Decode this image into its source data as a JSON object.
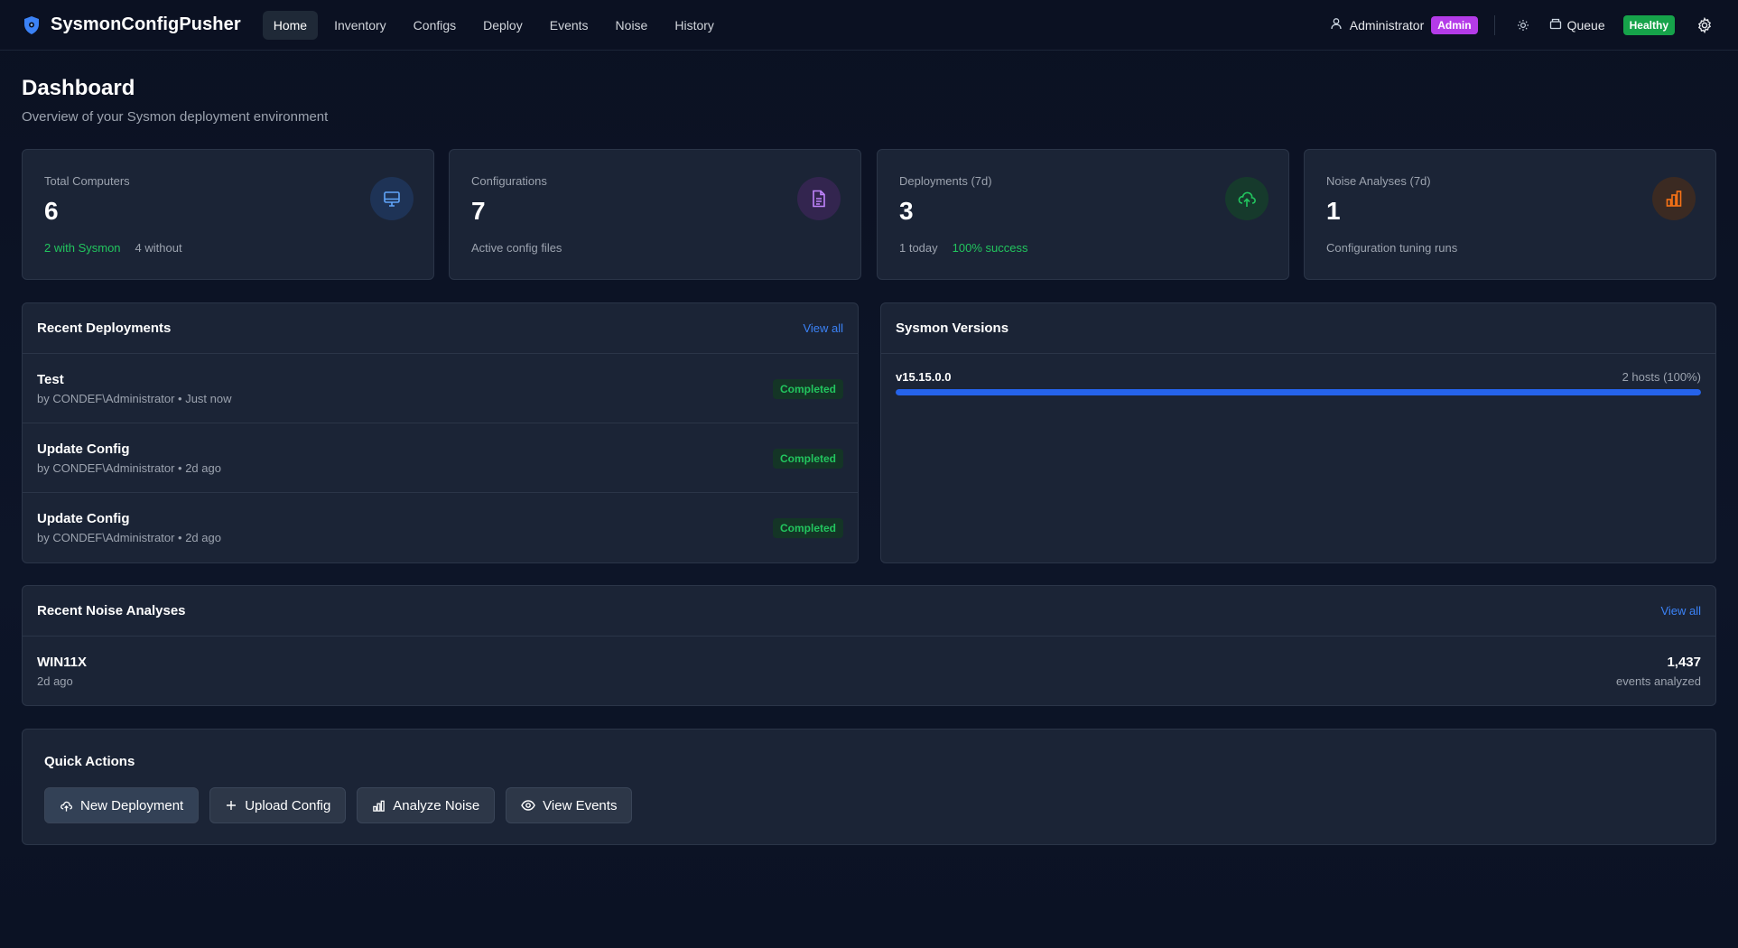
{
  "app": {
    "name": "SysmonConfigPusher",
    "nav": [
      "Home",
      "Inventory",
      "Configs",
      "Deploy",
      "Events",
      "Noise",
      "History"
    ],
    "active_nav": "Home",
    "user": "Administrator",
    "role_badge": "Admin",
    "queue_label": "Queue",
    "health_badge": "Healthy"
  },
  "page": {
    "title": "Dashboard",
    "subtitle": "Overview of your Sysmon deployment environment"
  },
  "stats": [
    {
      "label": "Total Computers",
      "value": "6",
      "foot": [
        "2 with Sysmon",
        "4 without"
      ],
      "icon": "monitor-icon",
      "color": "#60a5fa"
    },
    {
      "label": "Configurations",
      "value": "7",
      "foot": [
        "Active config files"
      ],
      "icon": "file-icon",
      "color": "#c084fc"
    },
    {
      "label": "Deployments (7d)",
      "value": "3",
      "foot": [
        "1 today",
        "100% success"
      ],
      "icon": "upload-cloud-icon",
      "color": "#22c55e"
    },
    {
      "label": "Noise Analyses (7d)",
      "value": "1",
      "foot": [
        "Configuration tuning runs"
      ],
      "icon": "bar-chart-icon",
      "color": "#f97316"
    }
  ],
  "recent_deployments": {
    "title": "Recent Deployments",
    "view_all": "View all",
    "items": [
      {
        "name": "Test",
        "meta": "by CONDEF\\Administrator • Just now",
        "status": "Completed"
      },
      {
        "name": "Update Config",
        "meta": "by CONDEF\\Administrator • 2d ago",
        "status": "Completed"
      },
      {
        "name": "Update Config",
        "meta": "by CONDEF\\Administrator • 2d ago",
        "status": "Completed"
      }
    ]
  },
  "sysmon_versions": {
    "title": "Sysmon Versions",
    "items": [
      {
        "version": "v15.15.0.0",
        "count": "2 hosts (100%)",
        "fraction": 1.0
      }
    ]
  },
  "recent_noise": {
    "title": "Recent Noise Analyses",
    "view_all": "View all",
    "items": [
      {
        "host": "WIN11X",
        "time": "2d ago",
        "count": "1,437",
        "unit": "events analyzed"
      }
    ]
  },
  "quick_actions": {
    "title": "Quick Actions",
    "buttons": [
      {
        "label": "New Deployment",
        "icon": "upload-cloud-icon"
      },
      {
        "label": "Upload Config",
        "icon": "plus-icon"
      },
      {
        "label": "Analyze Noise",
        "icon": "bar-chart-icon"
      },
      {
        "label": "View Events",
        "icon": "eye-icon"
      }
    ]
  }
}
